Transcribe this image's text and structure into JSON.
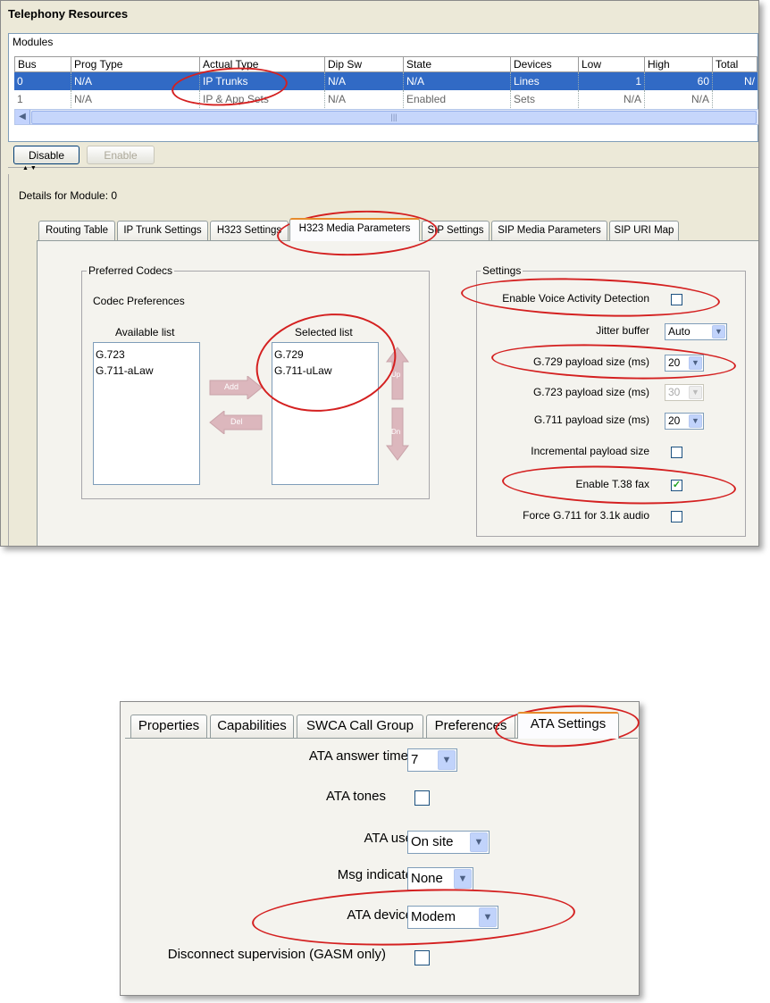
{
  "top_window": {
    "title": "Telephony Resources",
    "modules": {
      "label": "Modules",
      "columns": [
        "Bus",
        "Prog Type",
        "Actual Type",
        "Dip Sw",
        "State",
        "Devices",
        "Low",
        "High",
        "Total"
      ],
      "rows": [
        [
          "0",
          "N/A",
          "IP Trunks",
          "N/A",
          "N/A",
          "Lines",
          "1",
          "60",
          "N/"
        ],
        [
          "1",
          "N/A",
          "IP & App Sets",
          "N/A",
          "Enabled",
          "Sets",
          "N/A",
          "N/A",
          ""
        ]
      ]
    },
    "buttons": {
      "disable": "Disable",
      "enable": "Enable"
    },
    "details_label": "Details for Module: 0",
    "tabs": [
      "Routing Table",
      "IP Trunk Settings",
      "H323 Settings",
      "H323 Media Parameters",
      "SIP Settings",
      "SIP Media Parameters",
      "SIP URI Map"
    ],
    "active_tab": "H323 Media Parameters",
    "preferred_codecs": {
      "title": "Preferred Codecs",
      "subtitle": "Codec Preferences",
      "available_label": "Available list",
      "available": [
        "G.723",
        "G.711-aLaw"
      ],
      "selected_label": "Selected list",
      "selected": [
        "G.729",
        "G.711-uLaw"
      ],
      "add_label": "Add",
      "del_label": "Del",
      "up_label": "Up",
      "down_label": "Dn"
    },
    "settings": {
      "title": "Settings",
      "vad_label": "Enable Voice Activity Detection",
      "vad_checked": false,
      "jitter_label": "Jitter buffer",
      "jitter_value": "Auto",
      "g729_label": "G.729 payload size (ms)",
      "g729_value": "20",
      "g723_label": "G.723 payload size (ms)",
      "g723_value": "30",
      "g711_label": "G.711 payload size (ms)",
      "g711_value": "20",
      "incremental_label": "Incremental payload size",
      "incremental_checked": false,
      "t38_label": "Enable T.38 fax",
      "t38_checked": true,
      "force711_label": "Force G.711 for 3.1k audio",
      "force711_checked": false
    }
  },
  "bottom_window": {
    "tabs": [
      "Properties",
      "Capabilities",
      "SWCA Call Group",
      "Preferences",
      "ATA Settings"
    ],
    "active_tab": "ATA Settings",
    "fields": {
      "answer_timer_label": "ATA answer timer",
      "answer_timer_value": "7",
      "tones_label": "ATA tones",
      "tones_checked": false,
      "use_label": "ATA use",
      "use_value": "On site",
      "msg_label": "Msg indicate",
      "msg_value": "None",
      "device_label": "ATA device",
      "device_value": "Modem",
      "disconnect_label": "Disconnect supervision (GASM only)",
      "disconnect_checked": false
    }
  },
  "colors": {
    "annotation": "#d42020",
    "selection": "#316ac5",
    "tab_highlight": "#e68b2c"
  },
  "icons": {
    "dropdown": "chevron-down-icon",
    "check": "checkmark-icon",
    "scroll_left": "arrow-left-icon"
  }
}
